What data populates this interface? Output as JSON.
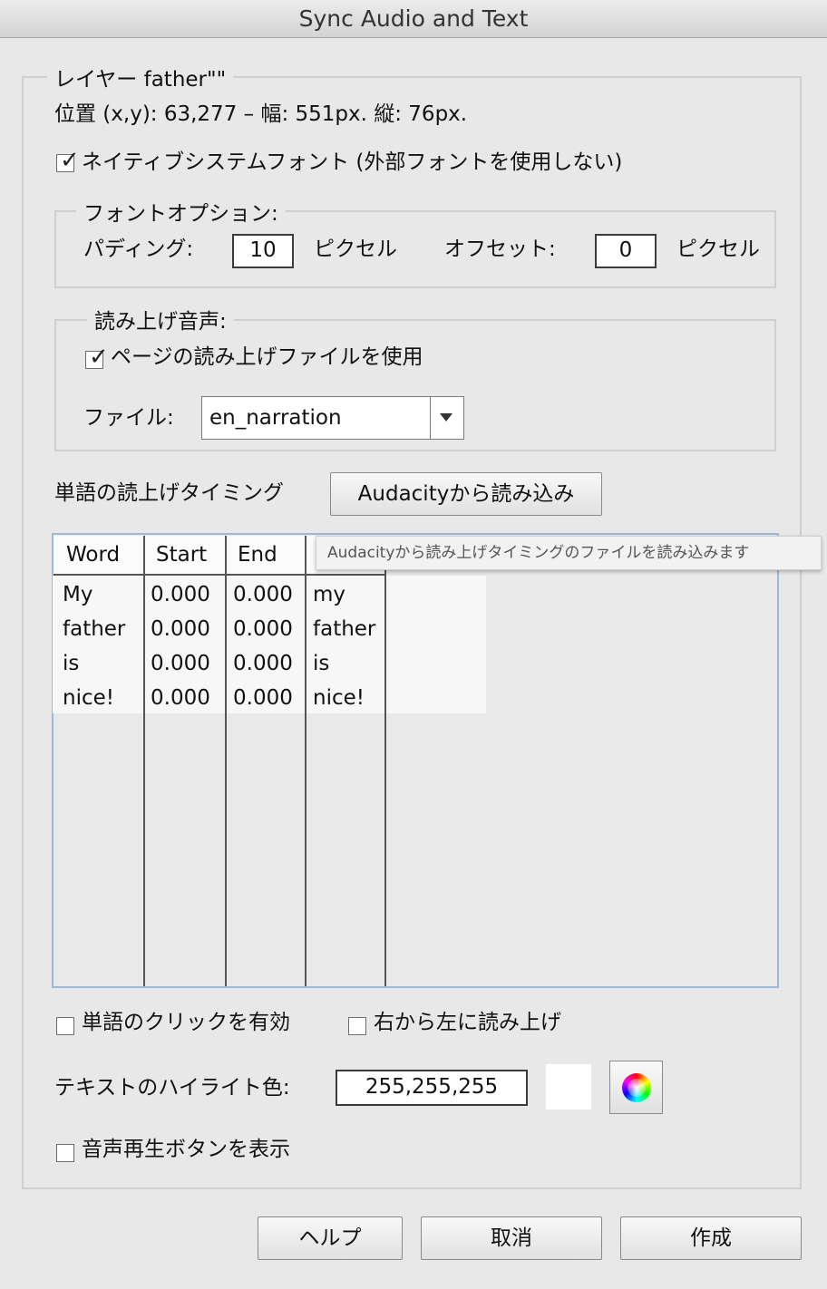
{
  "window": {
    "title": "Sync Audio and Text"
  },
  "layer": {
    "legend": "レイヤー father\"\"",
    "position_info": "位置 (x,y): 63,277 – 幅: 551px. 縦: 76px."
  },
  "native_font": {
    "checked": true,
    "label": "ネイティブシステムフォント (外部フォントを使用しない)"
  },
  "font_options": {
    "legend": "フォントオプション:",
    "padding_label": "パディング:",
    "padding_value": "10",
    "padding_unit": "ピクセル",
    "offset_label": "オフセット:",
    "offset_value": "0",
    "offset_unit": "ピクセル"
  },
  "narration": {
    "legend": "読み上げ音声:",
    "use_page_file": {
      "checked": true,
      "label": "ページの読み上げファイルを使用"
    },
    "file_label": "ファイル:",
    "file_value": "en_narration"
  },
  "timing": {
    "label": "単語の読上げタイミング",
    "import_button": "Audacityから読み込み",
    "tooltip": "Audacityから読み上げタイミングのファイルを読み込みます",
    "columns": [
      "Word",
      "Start",
      "End",
      ""
    ],
    "rows": [
      {
        "word": "My",
        "start": "0.000",
        "end": "0.000",
        "text": "my"
      },
      {
        "word": "father",
        "start": "0.000",
        "end": "0.000",
        "text": "father"
      },
      {
        "word": "is",
        "start": "0.000",
        "end": "0.000",
        "text": "is"
      },
      {
        "word": "nice!",
        "start": "0.000",
        "end": "0.000",
        "text": "nice!"
      }
    ]
  },
  "enable_word_click": {
    "checked": false,
    "label": "単語のクリックを有効"
  },
  "right_to_left": {
    "checked": false,
    "label": "右から左に読み上げ"
  },
  "highlight": {
    "label": "テキストのハイライト色:",
    "value": "255,255,255",
    "swatch_color": "#ffffff"
  },
  "show_play_button": {
    "checked": false,
    "label": "音声再生ボタンを表示"
  },
  "buttons": {
    "help": "ヘルプ",
    "cancel": "取消",
    "create": "作成"
  }
}
